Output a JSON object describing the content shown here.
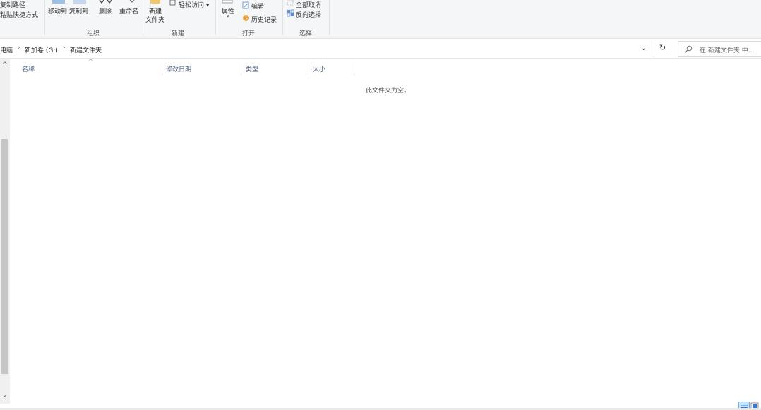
{
  "ribbon": {
    "clipboard": {
      "copy_path": "复制路径",
      "paste_shortcut": "粘贴快捷方式"
    },
    "organize": {
      "move_to": "移动到",
      "copy_to": "复制到",
      "delete": "删除",
      "rename": "重命名",
      "group_label": "组织"
    },
    "new": {
      "new_folder_line1": "新建",
      "new_folder_line2": "文件夹",
      "easy_access": "轻松访问 ▾",
      "group_label": "新建"
    },
    "open": {
      "properties": "属性",
      "edit": "编辑",
      "history": "历史记录",
      "group_label": "打开"
    },
    "select": {
      "select_none": "全部取消",
      "invert_selection": "反向选择",
      "group_label": "选择"
    }
  },
  "address": {
    "crumbs": [
      "电脑",
      "新加卷 (G:)",
      "新建文件夹"
    ],
    "separator": "›",
    "dropdown_glyph": "⌄",
    "refresh_glyph": "↻",
    "search_placeholder": "在 新建文件夹 中..."
  },
  "columns": {
    "name": "名称",
    "date_modified": "修改日期",
    "type": "类型",
    "size": "大小",
    "sort_glyph": "^"
  },
  "content": {
    "empty_message": "此文件夹为空。"
  },
  "scroll": {
    "up_glyph": "^",
    "down_glyph": "⌄"
  },
  "colors": {
    "accent": "#2f7bd6",
    "ribbon_bg": "#f5f6f7",
    "header_text": "#4d6082"
  }
}
